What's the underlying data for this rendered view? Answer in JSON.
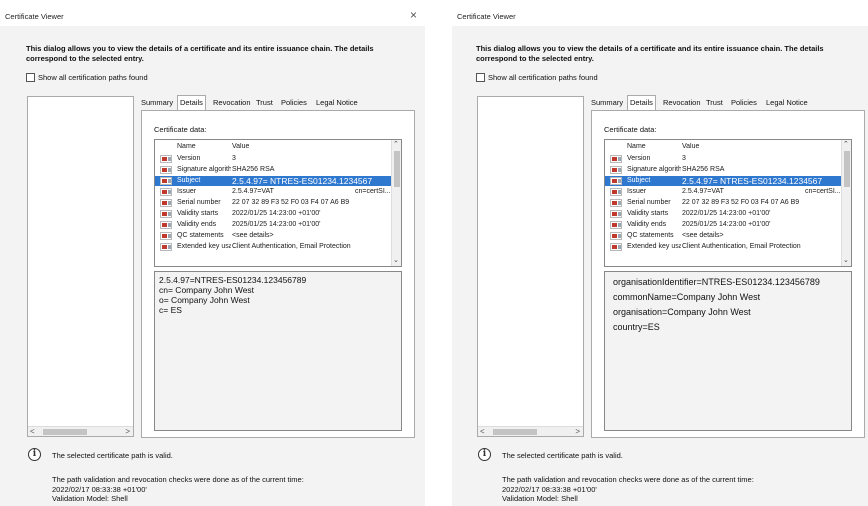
{
  "left": {
    "window_title": "Certificate Viewer",
    "close_glyph": "×",
    "intro_line1": "This dialog allows you to view the details of a certificate and its entire issuance chain. The details",
    "intro_line2": "correspond to the selected entry.",
    "show_all_label": "Show all certification paths found",
    "tabs": [
      "Summary",
      "Details",
      "Revocation",
      "Trust",
      "Policies",
      "Legal Notice"
    ],
    "active_tab": "Details",
    "certificate_data_label": "Certificate data:",
    "columns": {
      "name": "Name",
      "value": "Value"
    },
    "rows": [
      {
        "name": "Version",
        "value": "3",
        "value2": ""
      },
      {
        "name": "Signature algorith...",
        "value": "SHA256 RSA",
        "value2": ""
      },
      {
        "name": "Subject",
        "value": "2.5.4.97= NTRES-ES01234.1234567",
        "value2": ""
      },
      {
        "name": "Issuer",
        "value": "2.5.4.97=VAT",
        "value2": "cn=certSI..."
      },
      {
        "name": "Serial number",
        "value": "22 07 32 89 F3 52 F0 03 F4 07 A6 B9",
        "value2": ""
      },
      {
        "name": "Validity starts",
        "value": "2022/01/25 14:23:00 +01'00'",
        "value2": ""
      },
      {
        "name": "Validity ends",
        "value": "2025/01/25 14:23:00 +01'00'",
        "value2": ""
      },
      {
        "name": "QC statements",
        "value": "<see details>",
        "value2": ""
      },
      {
        "name": "Extended key usa...",
        "value": "Client Authentication, Email Protection",
        "value2": ""
      }
    ],
    "selected_row": "Subject",
    "detail_lines": [
      "2.5.4.97=NTRES-ES01234.123456789",
      "cn= Company John West",
      "o= Company John West",
      "c= ES"
    ],
    "status_message": "The selected certificate path is valid.",
    "validation_line1": "The path validation and revocation checks were done as of the current time:",
    "validation_line2": "2022/02/17 08:33:38 +01'00'",
    "validation_line3": "Validation Model: Shell"
  },
  "right": {
    "window_title": "Certificate Viewer",
    "intro_line1": "This dialog allows you to view the details of a certificate and its entire issuance chain. The details",
    "intro_line2": "correspond to the selected entry.",
    "show_all_label": "Show all certification paths found",
    "tabs": [
      "Summary",
      "Details",
      "Revocation",
      "Trust",
      "Policies",
      "Legal Notice"
    ],
    "active_tab": "Details",
    "certificate_data_label": "Certificate data:",
    "columns": {
      "name": "Name",
      "value": "Value"
    },
    "rows": [
      {
        "name": "Version",
        "value": "3",
        "value2": ""
      },
      {
        "name": "Signature algorith...",
        "value": "SHA256 RSA",
        "value2": ""
      },
      {
        "name": "Subject",
        "value": "2.5.4.97= NTRES-ES01234.1234567",
        "value2": ""
      },
      {
        "name": "Issuer",
        "value": "2.5.4.97=VAT",
        "value2": "cn=certSI..."
      },
      {
        "name": "Serial number",
        "value": "22 07 32 89 F3 52 F0 03 F4 07 A6 B9",
        "value2": ""
      },
      {
        "name": "Validity starts",
        "value": "2022/01/25 14:23:00 +01'00'",
        "value2": ""
      },
      {
        "name": "Validity ends",
        "value": "2025/01/25 14:23:00 +01'00'",
        "value2": ""
      },
      {
        "name": "QC statements",
        "value": "<see details>",
        "value2": ""
      },
      {
        "name": "Extended key usa...",
        "value": "Client Authentication, Email Protection",
        "value2": ""
      }
    ],
    "selected_row": "Subject",
    "detail_lines": [
      "organisationIdentifier=NTRES-ES01234.123456789",
      "commonName=Company John West",
      "organisation=Company John West",
      "country=ES"
    ],
    "status_message": "The selected certificate path is valid.",
    "validation_line1": "The path validation and revocation checks were done as of the current time:",
    "validation_line2": "2022/02/17 08:33:38 +01'00'",
    "validation_line3": "Validation Model: Shell"
  },
  "colors": {
    "selection": "#2f78cf",
    "dialog_bg": "#f3f3f3",
    "panel_bg": "#ffffff"
  }
}
